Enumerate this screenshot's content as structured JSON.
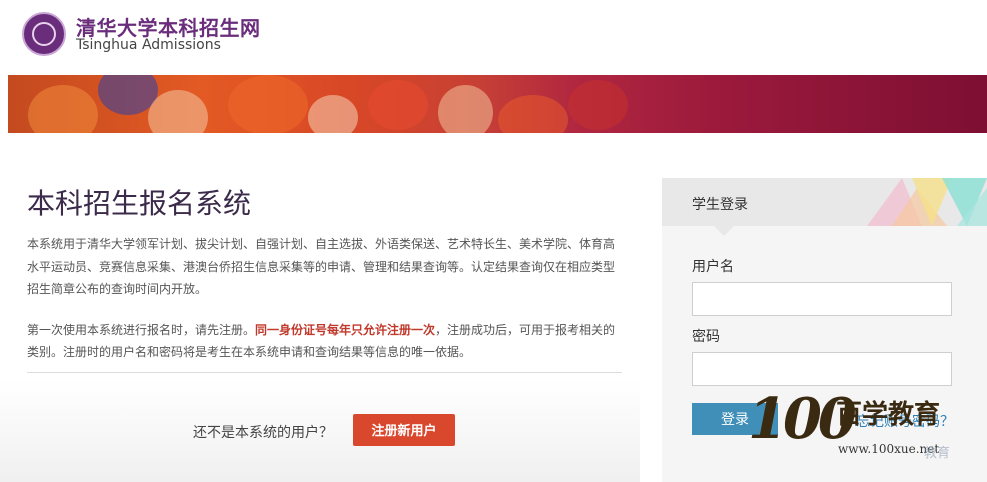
{
  "header": {
    "brand_cn": "清华大学本科招生网",
    "brand_en": "Tsinghua Admissions"
  },
  "main": {
    "title": "本科招生报名系统",
    "desc1": "本系统用于清华大学领军计划、拔尖计划、自强计划、自主选拔、外语类保送、艺术特长生、美术学院、体育高水平运动员、竞赛信息采集、港澳台侨招生信息采集等的申请、管理和结果查询等。认定结果查询仅在相应类型招生简章公布的查询时间内开放。",
    "desc2_pre": "第一次使用本系统进行报名时，请先注册。",
    "desc2_red": "同一身份证号每年只允许注册一次",
    "desc2_post": "，注册成功后，可用于报考相关的类别。注册时的用户名和密码将是考生在本系统申请和查询结果等信息的唯一依据。",
    "register_prompt": "还不是本系统的用户？",
    "register_button": "注册新用户"
  },
  "login": {
    "title": "学生登录",
    "username_label": "用户名",
    "username_value": "",
    "password_label": "密码",
    "password_value": "",
    "login_button": "登录",
    "forgot_link": "忘记账号密码？"
  },
  "watermark": {
    "number": "100",
    "name_cn": "百学教育",
    "url": "www.100xue.net",
    "tail": "教育"
  },
  "colors": {
    "brand_purple": "#6a2d7b",
    "register_red": "#d9472c",
    "login_blue": "#3f8fb8",
    "link_blue": "#2a7fb8"
  }
}
